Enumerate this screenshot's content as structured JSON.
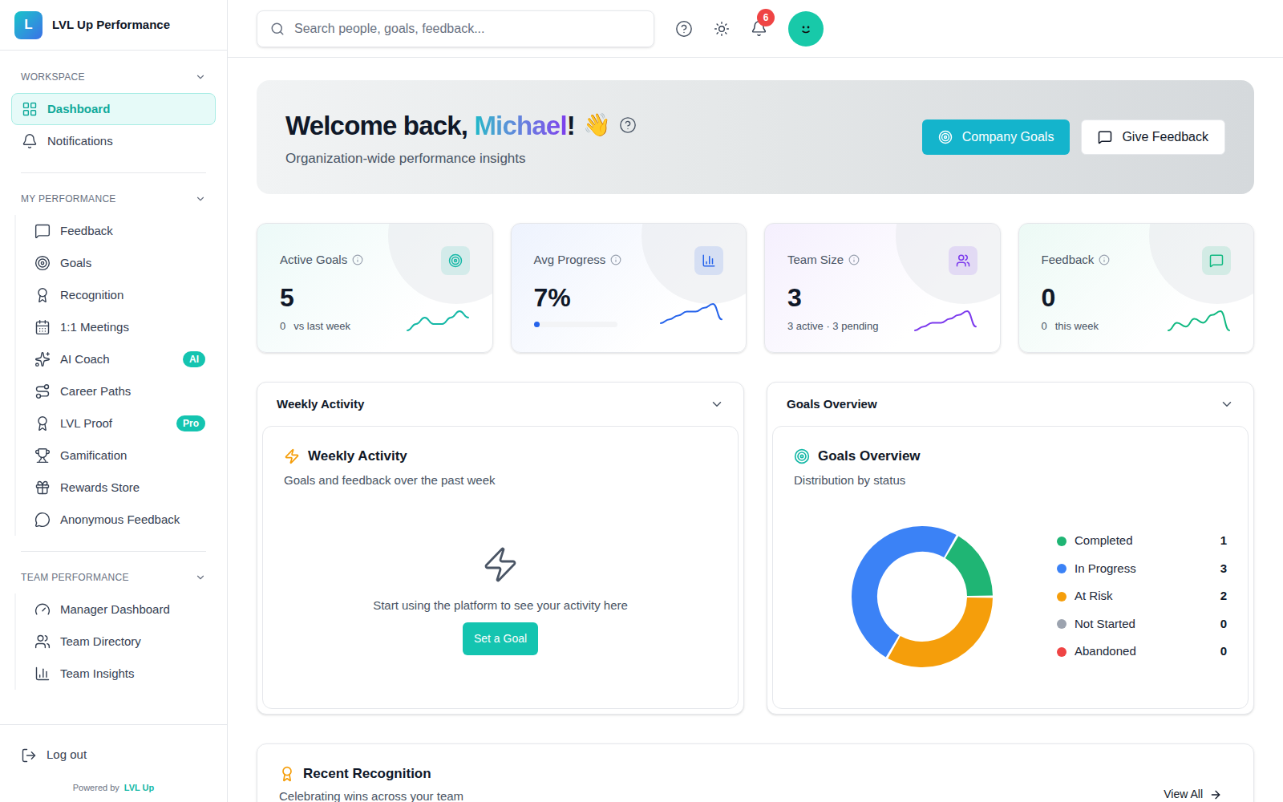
{
  "app": {
    "logo": "L",
    "name": "LVL Up Performance"
  },
  "search": {
    "placeholder": "Search people, goals, feedback..."
  },
  "notifications": {
    "count": "6"
  },
  "sidebar": {
    "sections": [
      {
        "title": "WORKSPACE",
        "expanded": true,
        "items": [
          {
            "label": "Dashboard",
            "selected": true
          },
          {
            "label": "Notifications",
            "selected": false
          }
        ]
      },
      {
        "title": "MY PERFORMANCE",
        "expanded": true,
        "items": [
          {
            "label": "Feedback",
            "selected": false
          },
          {
            "label": "Goals",
            "selected": false
          },
          {
            "label": "Recognition",
            "selected": false
          },
          {
            "label": "1:1 Meetings",
            "selected": false
          },
          {
            "label": "AI Coach",
            "selected": false,
            "badge": "AI"
          },
          {
            "label": "Career Paths",
            "selected": false
          },
          {
            "label": "LVL Proof",
            "selected": false,
            "badge": "Pro"
          },
          {
            "label": "Gamification",
            "selected": false
          },
          {
            "label": "Rewards Store",
            "selected": false
          },
          {
            "label": "Anonymous Feedback",
            "selected": false
          }
        ]
      },
      {
        "title": "TEAM PERFORMANCE",
        "expanded": true,
        "items": [
          {
            "label": "Manager Dashboard",
            "selected": false
          },
          {
            "label": "Team Directory",
            "selected": false
          },
          {
            "label": "Team Insights",
            "selected": false
          }
        ]
      }
    ],
    "footer": {
      "logout": "Log out",
      "powered_by": "Powered by",
      "brand": "LVL Up"
    }
  },
  "hero": {
    "greeting": "Welcome back, ",
    "name": "Michael",
    "punctuation": "!",
    "emoji": "👋",
    "subtitle": "Organization-wide performance insights",
    "buttons": [
      {
        "label": "Company Goals",
        "primary": true
      },
      {
        "label": "Give Feedback",
        "primary": false
      }
    ]
  },
  "stats": [
    {
      "kind": "delta",
      "label": "Active Goals",
      "value": "5",
      "delta": "0",
      "note": "vs last week",
      "color": "#14b8a6",
      "trend": [
        2,
        3,
        4,
        3,
        3,
        4,
        5,
        4
      ]
    },
    {
      "kind": "progress",
      "label": "Avg Progress",
      "value": "7%",
      "level": 0.07,
      "color": "#2563eb",
      "trend": [
        1,
        2,
        3,
        4,
        4,
        5,
        6,
        2
      ]
    },
    {
      "kind": "note",
      "label": "Team Size",
      "value": "3",
      "note": "3 active · 3 pending",
      "color": "#7c3aed",
      "trend": [
        1,
        2,
        3,
        3,
        4,
        5,
        6,
        2
      ]
    },
    {
      "kind": "delta",
      "label": "Feedback",
      "value": "0",
      "delta": "0",
      "note": "this week",
      "color": "#10b981",
      "trend": [
        1,
        3,
        2,
        4,
        3,
        5,
        6,
        1
      ]
    }
  ],
  "weekly": {
    "panel_title": "Weekly Activity",
    "expanded": true,
    "title": "Weekly Activity",
    "subtitle": "Goals and feedback over the past week",
    "empty": "Start using the platform to see your activity here",
    "button": "Set a Goal"
  },
  "goals": {
    "panel_title": "Goals Overview",
    "expanded": true,
    "title": "Goals Overview",
    "subtitle": "Distribution by status",
    "statuses": [
      {
        "label": "Completed",
        "count": "1",
        "value": 1,
        "color": "#1fb574"
      },
      {
        "label": "In Progress",
        "count": "3",
        "value": 3,
        "color": "#3b82f6"
      },
      {
        "label": "At Risk",
        "count": "2",
        "value": 2,
        "color": "#f59e0b"
      },
      {
        "label": "Not Started",
        "count": "0",
        "value": 0,
        "color": "#9ca3af"
      },
      {
        "label": "Abandoned",
        "count": "0",
        "value": 0,
        "color": "#ef4444"
      }
    ]
  },
  "recognition": {
    "title": "Recent Recognition",
    "subtitle": "Celebrating wins across your team",
    "link": "View All"
  }
}
